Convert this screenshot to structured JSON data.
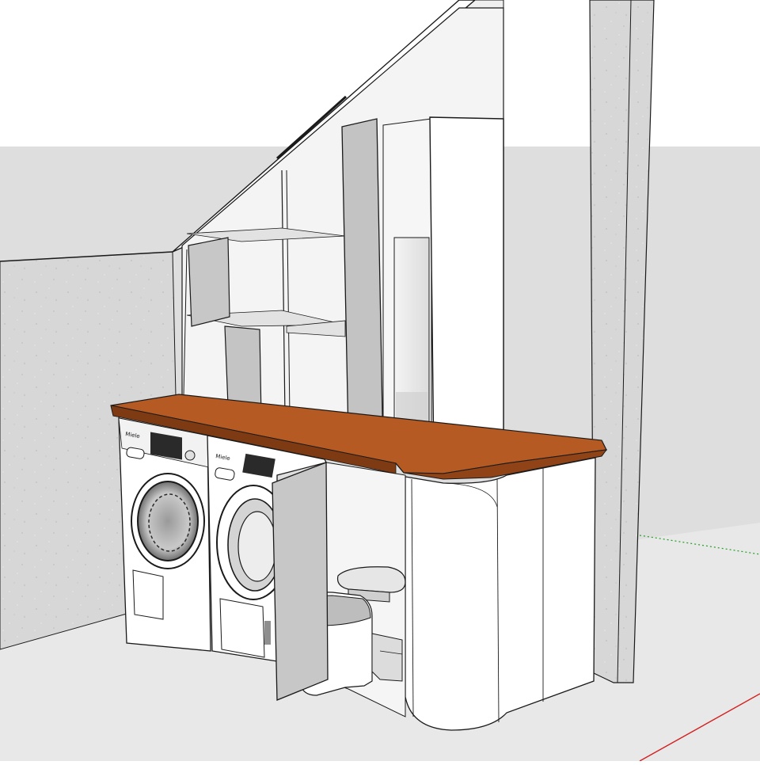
{
  "scene": {
    "subject": "",
    "colors": {
      "sky": "#ffffff",
      "ground": "#e6e6e6",
      "far_ground": "#dcdcdc",
      "wall_concrete": "#d9d9d9",
      "cabinet": "#ffffff",
      "door_grey": "#c8c8c8",
      "door_shadow": "#a9a9a9",
      "worktop": "#b45a22",
      "worktop_edge": "#8a3e14",
      "outline": "#1a1a1a",
      "axis_green": "#22a022",
      "axis_red": "#d42020"
    }
  },
  "appliances": {
    "washer_brand": "Miele",
    "dryer_brand": "Miele"
  }
}
